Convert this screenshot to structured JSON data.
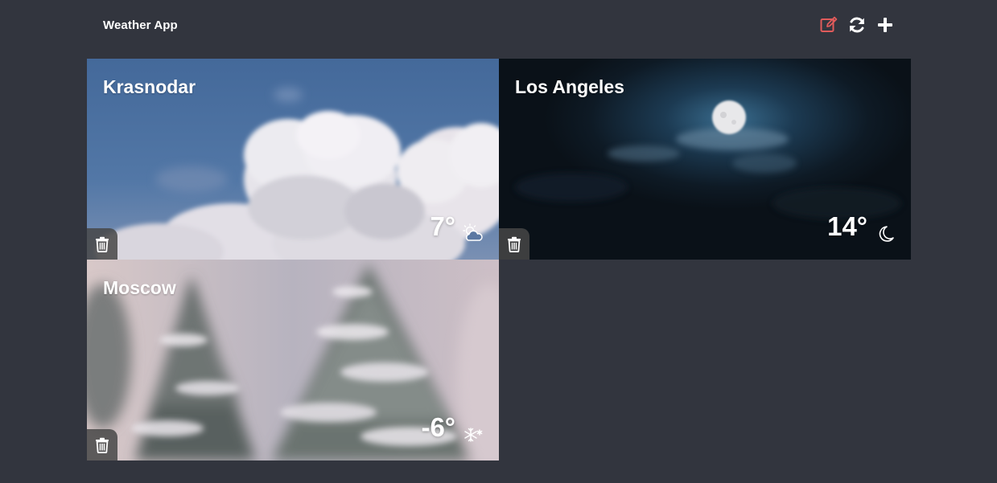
{
  "app": {
    "title": "Weather App"
  },
  "header": {
    "edit_icon": "edit-icon",
    "refresh_icon": "refresh-icon",
    "add_icon": "plus-icon",
    "edit_color": "#e05b5b"
  },
  "cards": [
    {
      "city": "Krasnodar",
      "temp": "7°",
      "condition_icon": "partly-cloudy-icon",
      "background": "cloudy-sky"
    },
    {
      "city": "Los Angeles",
      "temp": "14°",
      "condition_icon": "moon-icon",
      "background": "night-moon"
    },
    {
      "city": "Moscow",
      "temp": "-6°",
      "condition_icon": "snowflake-icon",
      "background": "snowy-trees"
    }
  ]
}
